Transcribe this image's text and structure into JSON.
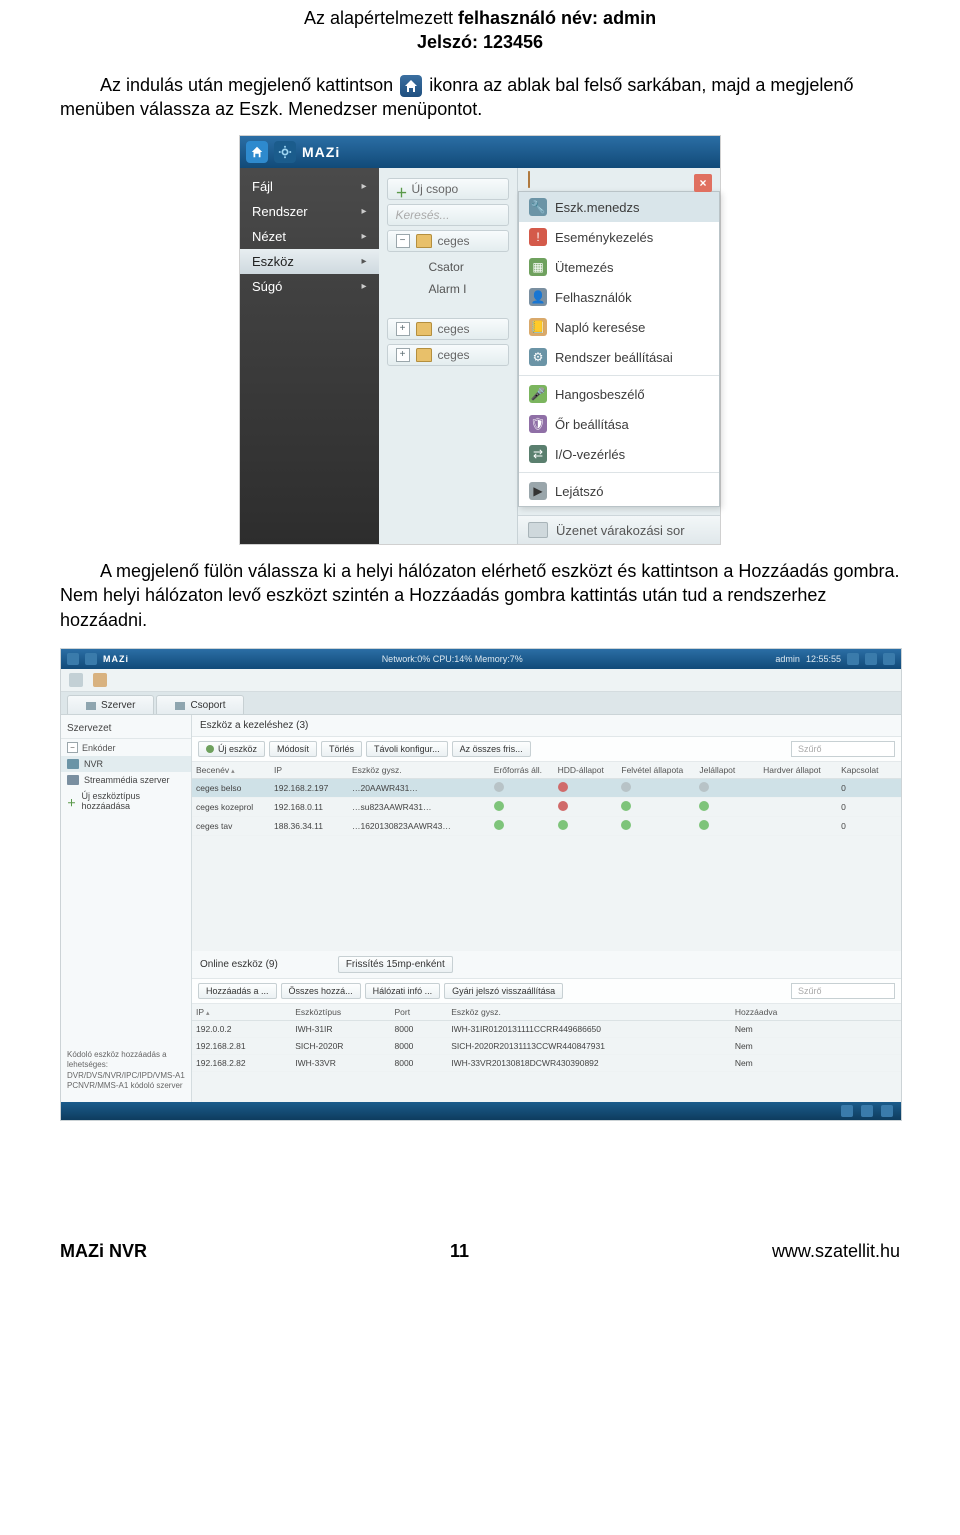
{
  "header": {
    "line1_prefix": "Az alapértelmezett ",
    "line1_bold": "felhasználó név: admin",
    "line2_bold": "Jelszó: 123456"
  },
  "para1": {
    "a": "Az indulás után megjelenő kattintson ",
    "b": " ikonra az ablak bal felső sarkában, majd a megjelenő menüben válassza az Eszk. Menedzser menüpontot."
  },
  "para2": "A megjelenő fülön válassza ki a helyi hálózaton elérhető eszközt és kattintson a Hozzáadás gombra. Nem helyi hálózaton levő eszközt szintén a Hozzáadás gombra kattintás után tud a rendszerhez hozzáadni.",
  "shot1": {
    "logo": "MAZi",
    "left_menu": [
      "Fájl",
      "Rendszer",
      "Nézet",
      "Eszköz",
      "Súgó"
    ],
    "left_selected_index": 3,
    "tree_uj_csoport": "Új csopo",
    "search_placeholder": "Keresés...",
    "tree_ceges": "ceges",
    "mid_labels": [
      "Csator",
      "Alarm I",
      "ceges",
      "ceges"
    ],
    "submenu": [
      "Eszk.menedzs",
      "Eseménykezelés",
      "Ütemezés",
      "Felhasználók",
      "Napló keresése",
      "Rendszer beállításai",
      "Hangosbeszélő",
      "Őr beállítása",
      "I/O-vezérlés",
      "Lejátszó"
    ],
    "submenu_selected_index": 0,
    "queue": "Üzenet várakozási sor"
  },
  "shot2": {
    "logo": "MAZi",
    "status_center": "Network:0% CPU:14% Memory:7%",
    "user": "admin",
    "time": "12:55:55",
    "tabs": [
      "Szerver",
      "Csoport"
    ],
    "side": {
      "header": "Szervezet",
      "group": "Enkóder",
      "items": [
        "NVR",
        "Streammédia szerver",
        "Új eszköztípus hozzáadása"
      ],
      "footnote": "Kódoló eszköz hozzáadás a lehetséges:\nDVR/DVS/NVR/IPC/IPD/VMS-A1 PCNVR/MMS-A1 kódoló szerver"
    },
    "section_top": "Eszköz a kezeléshez (3)",
    "actions_top": [
      "Új eszköz",
      "Módosít",
      "Törlés",
      "Távoli konfigur...",
      "Az összes fris..."
    ],
    "filter_placeholder": "Szűrő",
    "cols_top": [
      "Becenév",
      "IP",
      "Eszköz gysz.",
      "Erőforrás áll.",
      "HDD-állapot",
      "Felvétel állapota",
      "Jelállapot",
      "Hardver állapot",
      "Kapcsolat"
    ],
    "rows_top": [
      {
        "name": "ceges belso",
        "ip": "192.168.2.197",
        "serial": "…20AAWR431…",
        "res": "gray",
        "hdd": "red",
        "rec": "gray",
        "sig": "gray",
        "hw": "",
        "conn": "0",
        "sel": true
      },
      {
        "name": "ceges kozeprol",
        "ip": "192.168.0.11",
        "serial": "…su823AAWR431…",
        "res": "green",
        "hdd": "red",
        "rec": "green",
        "sig": "green",
        "hw": "",
        "conn": "0",
        "sel": false
      },
      {
        "name": "ceges tav",
        "ip": "188.36.34.11",
        "serial": "…1620130823AAWR43…",
        "res": "green",
        "hdd": "green",
        "rec": "green",
        "sig": "green",
        "hw": "",
        "conn": "0",
        "sel": false
      }
    ],
    "section_bottom": "Online eszköz (9)",
    "refresh_label": "Frissítés 15mp-enként",
    "actions_bottom": [
      "Hozzáadás a ...",
      "Összes hozzá...",
      "Hálózati infó ...",
      "Gyári jelszó visszaállítása"
    ],
    "cols_bottom": [
      "IP",
      "Eszköztípus",
      "Port",
      "Eszköz gysz.",
      "Hozzáadva"
    ],
    "rows_bottom": [
      {
        "ip": "192.0.0.2",
        "type": "IWH-31IR",
        "port": "8000",
        "serial": "IWH-31IR0120131111CCRR449686650",
        "added": "Nem"
      },
      {
        "ip": "192.168.2.81",
        "type": "SICH-2020R",
        "port": "8000",
        "serial": "SICH-2020R20131113CCWR440847931",
        "added": "Nem"
      },
      {
        "ip": "192.168.2.82",
        "type": "IWH-33VR",
        "port": "8000",
        "serial": "IWH-33VR20130818DCWR430390892",
        "added": "Nem"
      }
    ]
  },
  "footer": {
    "left": "MAZi NVR",
    "center": "11",
    "right": "www.szatellit.hu"
  }
}
